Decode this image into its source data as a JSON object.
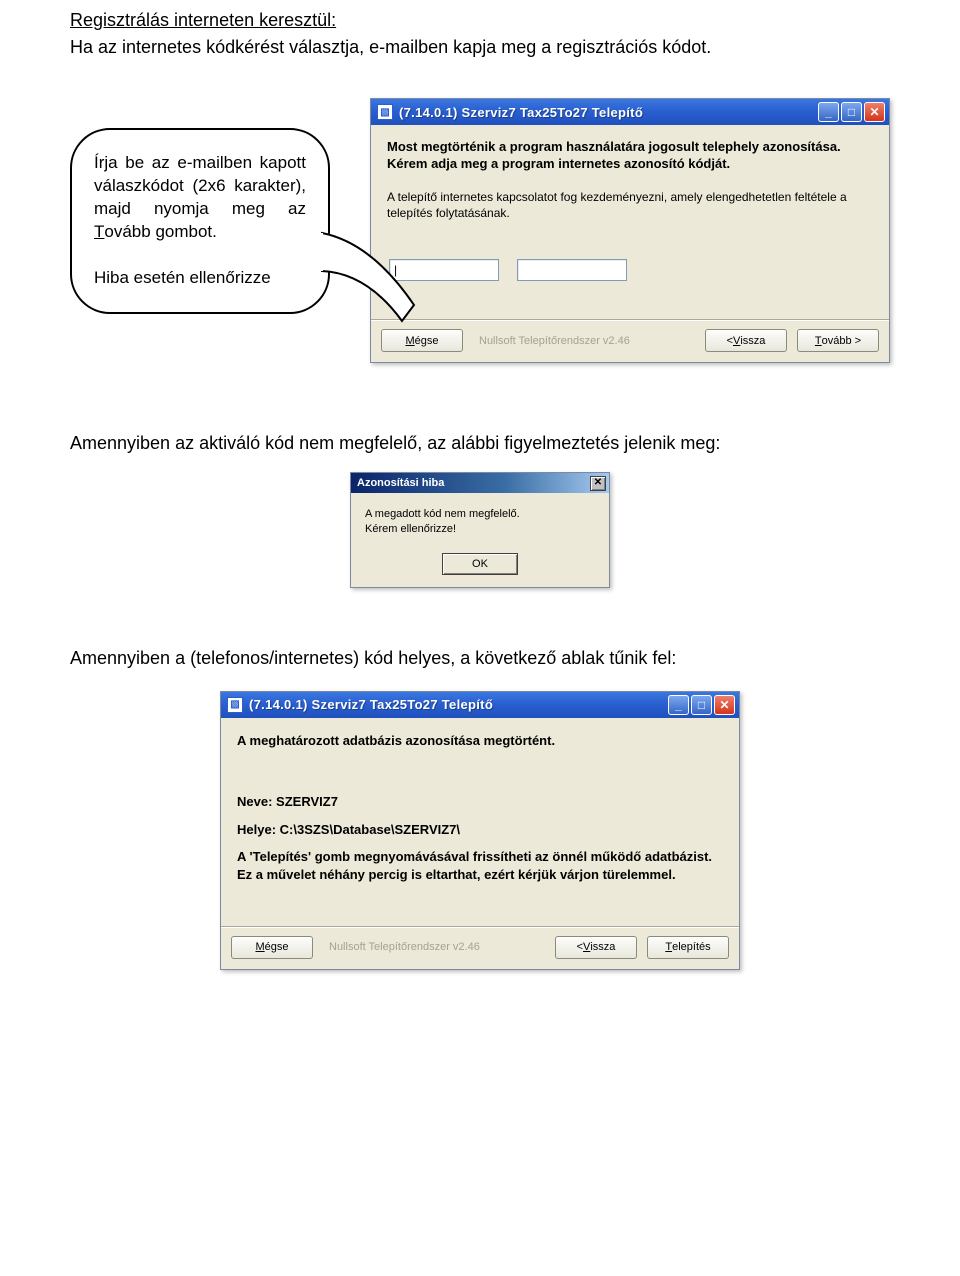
{
  "heading": "Regisztrálás interneten keresztül:",
  "intro": "Ha az internetes kódkérést választja, e-mailben kapja meg a regisztrációs kódot.",
  "callout": {
    "line1_before": "Írja be az e-mailben kapott válaszkódot (2x6 karakter), majd nyomja meg az ",
    "tovabb_letter": "T",
    "tovabb_rest": "ovább",
    "line1_after": " gombot.",
    "line2": "Hiba esetén ellenőrizze"
  },
  "win1": {
    "title": "(7.14.0.1) Szerviz7 Tax25To27 Telepítő",
    "body_bold": "Most megtörténik a program használatára jogosult telephely azonosítása. Kérem adja meg a program internetes azonosító kódját.",
    "body_plain": "A telepítő internetes kapcsolatot fog kezdeményezni, amely elengedhetetlen feltétele a telepítés folytatásának.",
    "input1": "|",
    "input2": "",
    "btn_cancel_u": "M",
    "btn_cancel_r": "égse",
    "sys": "Nullsoft Telepítőrendszer v2.46",
    "btn_back_pre": "< ",
    "btn_back_u": "V",
    "btn_back_r": "issza",
    "btn_next_u": "T",
    "btn_next_r": "ovább >"
  },
  "mid_text": "Amennyiben az aktiváló kód nem megfelelő, az alábbi figyelmeztetés jelenik meg:",
  "error_dlg": {
    "title": "Azonosítási hiba",
    "line1": "A megadott kód nem megfelelő.",
    "line2": "Kérem ellenőrizze!",
    "ok": "OK"
  },
  "mid_text2": "Amennyiben a (telefonos/internetes) kód helyes, a következő ablak tűnik fel:",
  "win2": {
    "title": "(7.14.0.1) Szerviz7 Tax25To27 Telepítő",
    "line1": "A meghatározott adatbázis azonosítása megtörtént.",
    "name_label": "Neve: ",
    "name_value": "SZERVIZ7",
    "path_label": "Helye: ",
    "path_value": "C:\\3SZS\\Database\\SZERVIZ7\\",
    "desc": "A 'Telepítés' gomb megnyomávásával frissítheti az önnél működő adatbázist. Ez a művelet néhány percig is eltarthat, ezért kérjük várjon türelemmel.",
    "btn_cancel_u": "M",
    "btn_cancel_r": "égse",
    "sys": "Nullsoft Telepítőrendszer v2.46",
    "btn_back_pre": "< ",
    "btn_back_u": "V",
    "btn_back_r": "issza",
    "btn_install_u": "T",
    "btn_install_r": "elepítés"
  }
}
